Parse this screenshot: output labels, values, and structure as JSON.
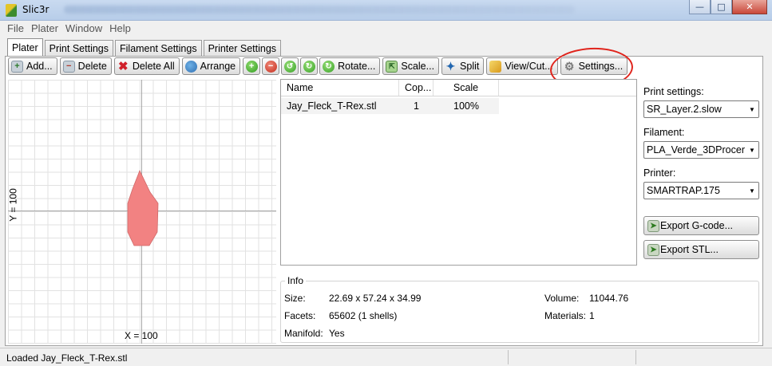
{
  "window": {
    "title": "Slic3r",
    "title_icon": "slic3r-logo-icon"
  },
  "menu": [
    "File",
    "Plater",
    "Window",
    "Help"
  ],
  "tabs": [
    {
      "label": "Plater",
      "active": true
    },
    {
      "label": "Print Settings",
      "active": false
    },
    {
      "label": "Filament Settings",
      "active": false
    },
    {
      "label": "Printer Settings",
      "active": false
    }
  ],
  "toolbar": {
    "add": "Add...",
    "delete": "Delete",
    "delete_all": "Delete All",
    "arrange": "Arrange",
    "rotate": "Rotate...",
    "scale": "Scale...",
    "split": "Split",
    "view_cut": "View/Cut...",
    "settings": "Settings..."
  },
  "plater": {
    "y_label": "Y = 100",
    "x_label": "X = 100",
    "object_color": "#f28282"
  },
  "object_list": {
    "headers": [
      "Name",
      "Cop...",
      "Scale"
    ],
    "rows": [
      {
        "name": "Jay_Fleck_T-Rex.stl",
        "copies": "1",
        "scale": "100%"
      }
    ]
  },
  "side": {
    "print_label": "Print settings:",
    "print_value": "SR_Layer.2.slow",
    "filament_label": "Filament:",
    "filament_value": "PLA_Verde_3DProcer",
    "printer_label": "Printer:",
    "printer_value": "SMARTRAP.175",
    "export_gcode": "Export G-code...",
    "export_stl": "Export STL..."
  },
  "info": {
    "title": "Info",
    "size_label": "Size:",
    "size_value": "22.69 x 57.24 x 34.99",
    "volume_label": "Volume:",
    "volume_value": "11044.76",
    "facets_label": "Facets:",
    "facets_value": "65602 (1 shells)",
    "materials_label": "Materials:",
    "materials_value": "1",
    "manifold_label": "Manifold:",
    "manifold_value": "Yes"
  },
  "status": {
    "message": "Loaded Jay_Fleck_T-Rex.stl"
  },
  "colors": {
    "annotation": "#e0241c",
    "object": "#f28282"
  }
}
